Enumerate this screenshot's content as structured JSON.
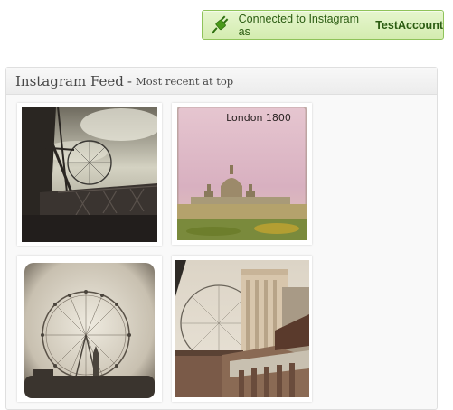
{
  "notice": {
    "text": "Connected to Instagram as",
    "account": "TestAccount",
    "icon": "plug-icon",
    "color": "#2b5c12"
  },
  "panel": {
    "title": "Instagram Feed",
    "separator": "-",
    "subtitle": "Most recent at top"
  },
  "photos": [
    {
      "caption": "",
      "icon": "photo-thumbnail"
    },
    {
      "caption": "London 1800",
      "icon": "photo-thumbnail"
    },
    {
      "caption": "",
      "icon": "photo-thumbnail"
    },
    {
      "caption": "",
      "icon": "photo-thumbnail"
    }
  ]
}
